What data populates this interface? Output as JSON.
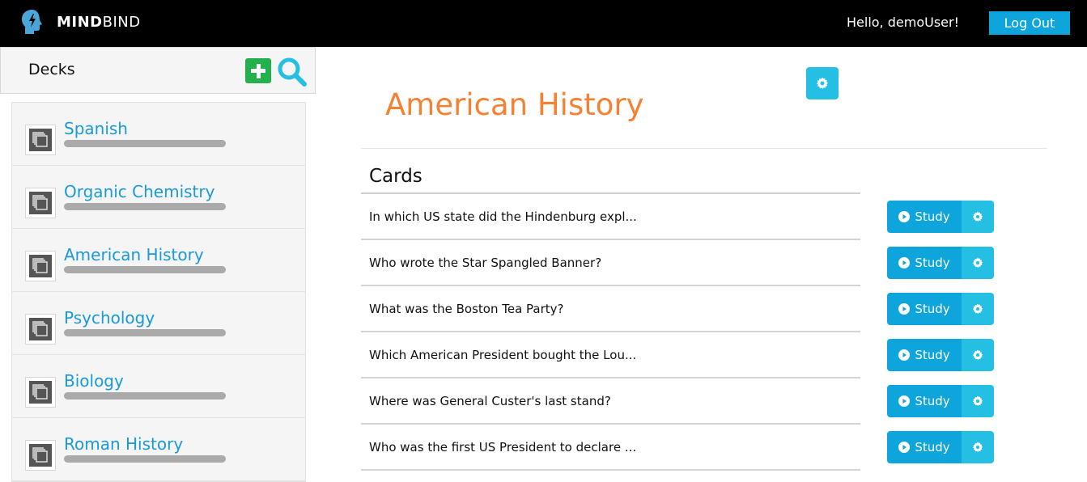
{
  "app": {
    "brand_bold": "MIND",
    "brand_light": "BIND"
  },
  "header": {
    "greeting": "Hello, demoUser!",
    "logout_label": "Log Out"
  },
  "sidebar": {
    "title": "Decks",
    "decks": [
      {
        "name": "Spanish"
      },
      {
        "name": "Organic Chemistry"
      },
      {
        "name": "American History"
      },
      {
        "name": "Psychology"
      },
      {
        "name": "Biology"
      },
      {
        "name": "Roman History"
      }
    ]
  },
  "main": {
    "deck_title": "American History",
    "cards_heading": "Cards",
    "study_label": "Study",
    "cards": [
      {
        "question": "In which US state did the Hindenburg expl..."
      },
      {
        "question": "Who wrote the Star Spangled Banner?"
      },
      {
        "question": "What was the Boston Tea Party?"
      },
      {
        "question": "Which American President bought the Lou..."
      },
      {
        "question": "Where was General Custer's last stand?"
      },
      {
        "question": "Who was the first US President to declare ..."
      }
    ]
  },
  "colors": {
    "accent_blue": "#0ea5dd",
    "accent_cyan": "#25bfe3",
    "title_orange": "#f58233",
    "deck_link": "#1a9ad9",
    "add_green": "#22b14c"
  },
  "icons": [
    "brain-logo-icon",
    "plus-icon",
    "search-icon",
    "gear-icon",
    "play-circle-icon",
    "stacked-cards-icon"
  ]
}
